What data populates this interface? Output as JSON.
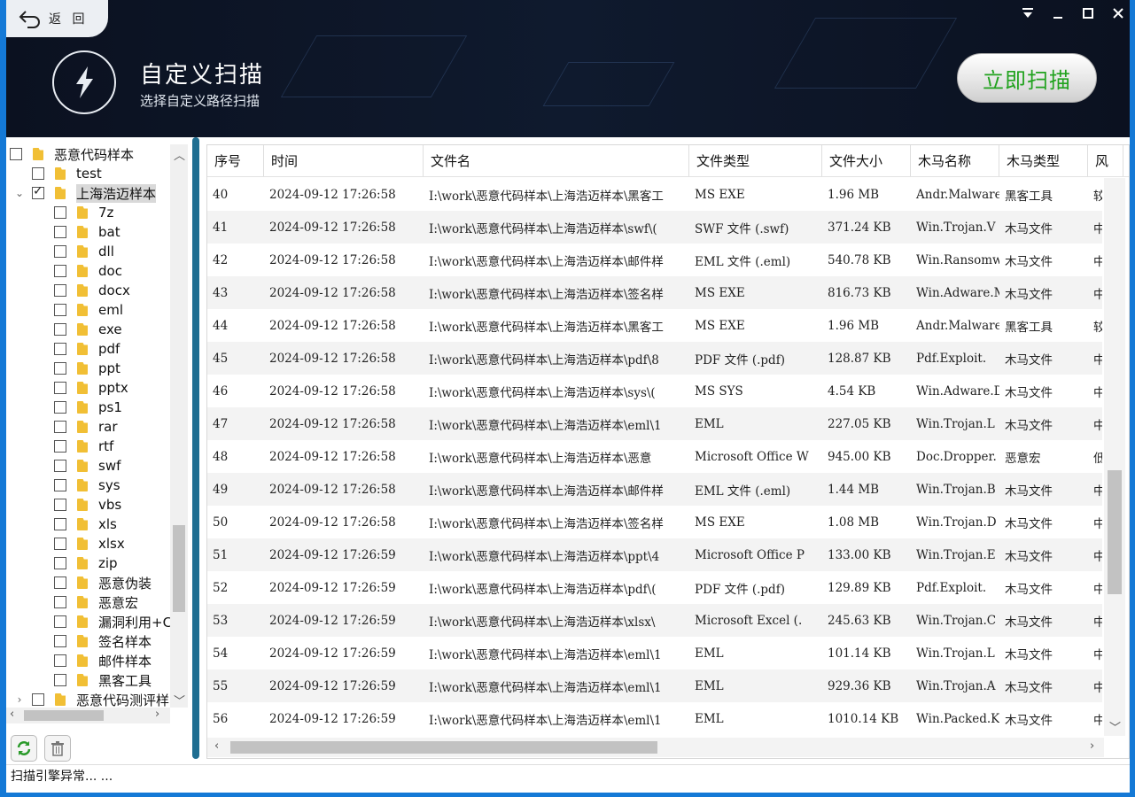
{
  "header": {
    "back_label": "返 回",
    "title": "自定义扫描",
    "subtitle": "选择自定义路径扫描",
    "scan_button": "立即扫描"
  },
  "tree": {
    "items": [
      {
        "label": "恶意代码样本",
        "level": 0,
        "checked": false,
        "expander": "",
        "selected": false
      },
      {
        "label": "test",
        "level": 1,
        "checked": false,
        "expander": "",
        "selected": false
      },
      {
        "label": "上海浩迈样本",
        "level": 1,
        "checked": true,
        "expander": "expanded",
        "selected": true
      },
      {
        "label": "7z",
        "level": 2,
        "checked": false,
        "expander": "",
        "selected": false
      },
      {
        "label": "bat",
        "level": 2,
        "checked": false,
        "expander": "",
        "selected": false
      },
      {
        "label": "dll",
        "level": 2,
        "checked": false,
        "expander": "",
        "selected": false
      },
      {
        "label": "doc",
        "level": 2,
        "checked": false,
        "expander": "",
        "selected": false
      },
      {
        "label": "docx",
        "level": 2,
        "checked": false,
        "expander": "",
        "selected": false
      },
      {
        "label": "eml",
        "level": 2,
        "checked": false,
        "expander": "",
        "selected": false
      },
      {
        "label": "exe",
        "level": 2,
        "checked": false,
        "expander": "",
        "selected": false
      },
      {
        "label": "pdf",
        "level": 2,
        "checked": false,
        "expander": "",
        "selected": false
      },
      {
        "label": "ppt",
        "level": 2,
        "checked": false,
        "expander": "",
        "selected": false
      },
      {
        "label": "pptx",
        "level": 2,
        "checked": false,
        "expander": "",
        "selected": false
      },
      {
        "label": "ps1",
        "level": 2,
        "checked": false,
        "expander": "",
        "selected": false
      },
      {
        "label": "rar",
        "level": 2,
        "checked": false,
        "expander": "",
        "selected": false
      },
      {
        "label": "rtf",
        "level": 2,
        "checked": false,
        "expander": "",
        "selected": false
      },
      {
        "label": "swf",
        "level": 2,
        "checked": false,
        "expander": "",
        "selected": false
      },
      {
        "label": "sys",
        "level": 2,
        "checked": false,
        "expander": "",
        "selected": false
      },
      {
        "label": "vbs",
        "level": 2,
        "checked": false,
        "expander": "",
        "selected": false
      },
      {
        "label": "xls",
        "level": 2,
        "checked": false,
        "expander": "",
        "selected": false
      },
      {
        "label": "xlsx",
        "level": 2,
        "checked": false,
        "expander": "",
        "selected": false
      },
      {
        "label": "zip",
        "level": 2,
        "checked": false,
        "expander": "",
        "selected": false
      },
      {
        "label": "恶意伪装",
        "level": 2,
        "checked": false,
        "expander": "",
        "selected": false
      },
      {
        "label": "恶意宏",
        "level": 2,
        "checked": false,
        "expander": "",
        "selected": false
      },
      {
        "label": "漏洞利用+C",
        "level": 2,
        "checked": false,
        "expander": "",
        "selected": false
      },
      {
        "label": "签名样本",
        "level": 2,
        "checked": false,
        "expander": "",
        "selected": false
      },
      {
        "label": "邮件样本",
        "level": 2,
        "checked": false,
        "expander": "",
        "selected": false
      },
      {
        "label": "黑客工具",
        "level": 2,
        "checked": false,
        "expander": "",
        "selected": false
      },
      {
        "label": "恶意代码测评样",
        "level": 1,
        "checked": false,
        "expander": "collapsed",
        "selected": false
      }
    ]
  },
  "table": {
    "columns": [
      "序号",
      "时间",
      "文件名",
      "文件类型",
      "文件大小",
      "木马名称",
      "木马类型",
      "风"
    ],
    "rows": [
      [
        "40",
        "2024-09-12 17:26:58",
        "I:\\work\\恶意代码样本\\上海浩迈样本\\黑客工",
        "MS EXE",
        "1.96 MB",
        "Andr.Malware",
        "黑客工具",
        "较"
      ],
      [
        "41",
        "2024-09-12 17:26:58",
        "I:\\work\\恶意代码样本\\上海浩迈样本\\swf\\(",
        "SWF 文件 (.swf)",
        "371.24 KB",
        "Win.Trojan.V",
        "木马文件",
        "中"
      ],
      [
        "42",
        "2024-09-12 17:26:58",
        "I:\\work\\恶意代码样本\\上海浩迈样本\\邮件样",
        "EML 文件 (.eml)",
        "540.78 KB",
        "Win.Ransomwa",
        "木马文件",
        "中"
      ],
      [
        "43",
        "2024-09-12 17:26:58",
        "I:\\work\\恶意代码样本\\上海浩迈样本\\签名样",
        "MS EXE",
        "816.73 KB",
        "Win.Adware.M",
        "木马文件",
        "中"
      ],
      [
        "44",
        "2024-09-12 17:26:58",
        "I:\\work\\恶意代码样本\\上海浩迈样本\\黑客工",
        "MS EXE",
        "1.96 MB",
        "Andr.Malware",
        "黑客工具",
        "较"
      ],
      [
        "45",
        "2024-09-12 17:26:58",
        "I:\\work\\恶意代码样本\\上海浩迈样本\\pdf\\8",
        "PDF 文件 (.pdf)",
        "128.87 KB",
        "Pdf.Exploit.",
        "木马文件",
        "中"
      ],
      [
        "46",
        "2024-09-12 17:26:58",
        "I:\\work\\恶意代码样本\\上海浩迈样本\\sys\\(",
        "MS SYS",
        "4.54 KB",
        "Win.Adware.D",
        "木马文件",
        "中"
      ],
      [
        "47",
        "2024-09-12 17:26:58",
        "I:\\work\\恶意代码样本\\上海浩迈样本\\eml\\1",
        "EML",
        "227.05 KB",
        "Win.Trojan.L",
        "木马文件",
        "中"
      ],
      [
        "48",
        "2024-09-12 17:26:58",
        "I:\\work\\恶意代码样本\\上海浩迈样本\\恶意",
        "Microsoft Office W",
        "945.00 KB",
        "Doc.Dropper.",
        "恶意宏",
        "低"
      ],
      [
        "49",
        "2024-09-12 17:26:58",
        "I:\\work\\恶意代码样本\\上海浩迈样本\\邮件样",
        "EML 文件 (.eml)",
        "1.44 MB",
        "Win.Trojan.B",
        "木马文件",
        "中"
      ],
      [
        "50",
        "2024-09-12 17:26:58",
        "I:\\work\\恶意代码样本\\上海浩迈样本\\签名样",
        "MS EXE",
        "1.08 MB",
        "Win.Trojan.D",
        "木马文件",
        "中"
      ],
      [
        "51",
        "2024-09-12 17:26:59",
        "I:\\work\\恶意代码样本\\上海浩迈样本\\ppt\\4",
        "Microsoft Office P",
        "133.00 KB",
        "Win.Trojan.E",
        "木马文件",
        "中"
      ],
      [
        "52",
        "2024-09-12 17:26:59",
        "I:\\work\\恶意代码样本\\上海浩迈样本\\pdf\\(",
        "PDF 文件 (.pdf)",
        "129.89 KB",
        "Pdf.Exploit.",
        "木马文件",
        "中"
      ],
      [
        "53",
        "2024-09-12 17:26:59",
        "I:\\work\\恶意代码样本\\上海浩迈样本\\xlsx\\",
        "Microsoft Excel (.",
        "245.63 KB",
        "Win.Trojan.C",
        "木马文件",
        "中"
      ],
      [
        "54",
        "2024-09-12 17:26:59",
        "I:\\work\\恶意代码样本\\上海浩迈样本\\eml\\1",
        "EML",
        "101.14 KB",
        "Win.Trojan.L",
        "木马文件",
        "中"
      ],
      [
        "55",
        "2024-09-12 17:26:59",
        "I:\\work\\恶意代码样本\\上海浩迈样本\\eml\\1",
        "EML",
        "929.36 KB",
        "Win.Trojan.A",
        "木马文件",
        "中"
      ],
      [
        "56",
        "2024-09-12 17:26:59",
        "I:\\work\\恶意代码样本\\上海浩迈样本\\eml\\1",
        "EML",
        "1010.14 KB",
        "Win.Packed.K",
        "木马文件",
        "中"
      ]
    ]
  },
  "status": {
    "text": "扫描引擎异常... ..."
  },
  "colors": {
    "accent": "#1479d6",
    "scan_text": "#21a21e",
    "folder": "#f1bf35",
    "splitter": "#1f6e91"
  }
}
